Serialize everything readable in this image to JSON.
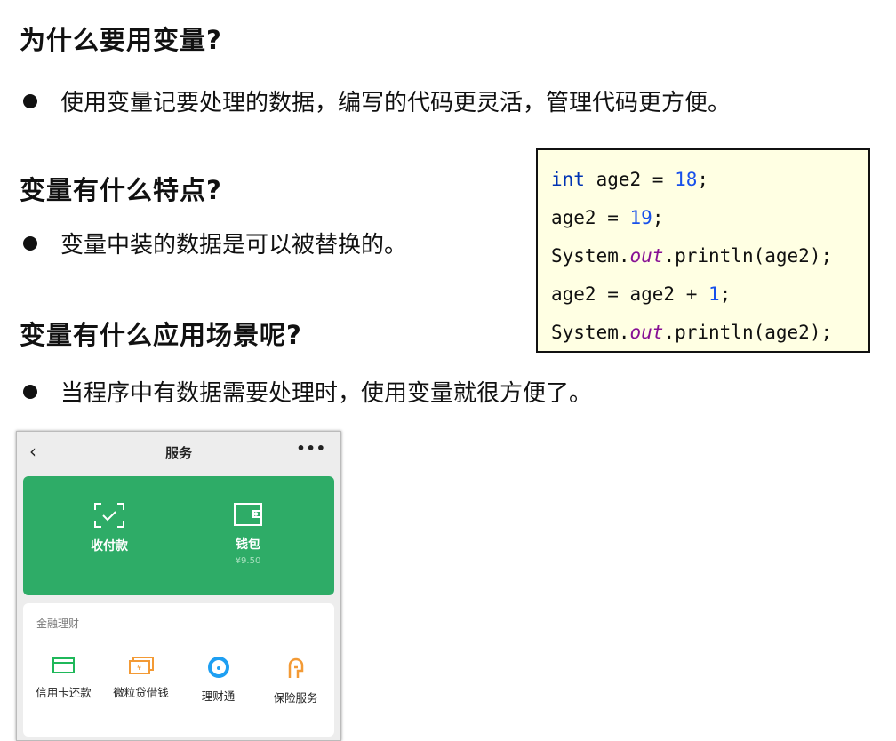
{
  "sections": [
    {
      "heading": "为什么要用变量?",
      "bullet": "使用变量记要处理的数据，编写的代码更灵活，管理代码更方便。"
    },
    {
      "heading": "变量有什么特点?",
      "bullet": "变量中装的数据是可以被替换的。"
    },
    {
      "heading": "变量有什么应用场景呢?",
      "bullet": "当程序中有数据需要处理时，使用变量就很方便了。"
    }
  ],
  "code": {
    "l1": {
      "kw": "int",
      "a": " age2 = ",
      "num": "18",
      "b": ";"
    },
    "l2": {
      "a": "age2 = ",
      "num": "19",
      "b": ";"
    },
    "l3": {
      "a": "System.",
      "fld": "out",
      "b": ".println(age2);"
    },
    "l4": {
      "a": "age2 = age2 + ",
      "num": "1",
      "b": ";"
    },
    "l5": {
      "a": "System.",
      "fld": "out",
      "b": ".println(age2);"
    }
  },
  "phone": {
    "back": "‹",
    "title": "服务",
    "more": "•••",
    "pay": "收付款",
    "wallet": "钱包",
    "wallet_balance": "¥9.50",
    "section": "金融理财",
    "items": [
      "信用卡还款",
      "微粒贷借钱",
      "理财通",
      "保险服务"
    ],
    "colors": {
      "green": "#2eac67",
      "credit": "#1fb85a",
      "loan": "#f39a35",
      "licai": "#1e9ff2",
      "insurance": "#f39a35"
    }
  }
}
